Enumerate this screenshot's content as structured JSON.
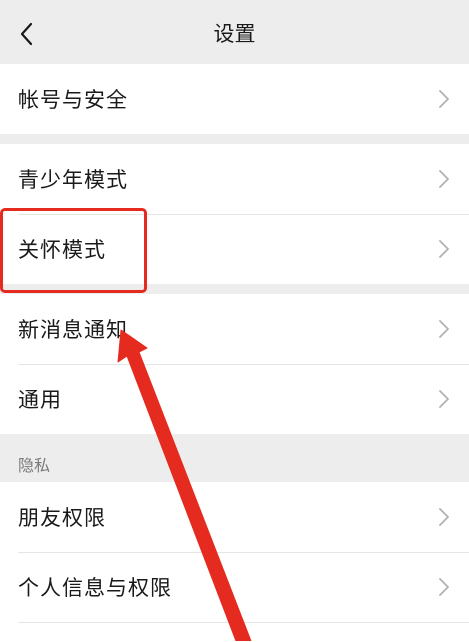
{
  "nav": {
    "title": "设置",
    "back_icon": "chevron-left-icon"
  },
  "sections": [
    {
      "items": [
        {
          "label": "帐号与安全"
        }
      ]
    },
    {
      "items": [
        {
          "label": "青少年模式"
        },
        {
          "label": "关怀模式"
        }
      ]
    },
    {
      "items": [
        {
          "label": "新消息通知"
        },
        {
          "label": "通用"
        }
      ]
    },
    {
      "header": "隐私",
      "items": [
        {
          "label": "朋友权限"
        },
        {
          "label": "个人信息与权限"
        }
      ]
    }
  ],
  "annotation": {
    "highlight_color": "#e52a1f",
    "highlighted_item": "关怀模式"
  },
  "colors": {
    "background": "#ededed",
    "row_background": "#ffffff",
    "chevron": "#b2b2b2",
    "accent_annotation": "#e52a1f"
  }
}
